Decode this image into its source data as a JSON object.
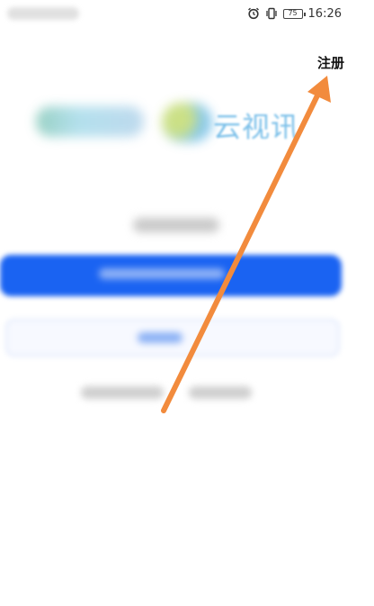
{
  "status_bar": {
    "time": "16:26",
    "battery_level": "75",
    "icons": [
      "alarm-icon",
      "vibrate-icon",
      "battery-icon"
    ]
  },
  "header": {
    "register_label": "注册"
  },
  "logo": {
    "app_name": "云视讯"
  },
  "colors": {
    "primary_button": "#1a63f2",
    "arrow": "#f28b3d",
    "app_name_text": "#7cc0e9"
  },
  "annotation": {
    "icon": "arrow-icon"
  }
}
